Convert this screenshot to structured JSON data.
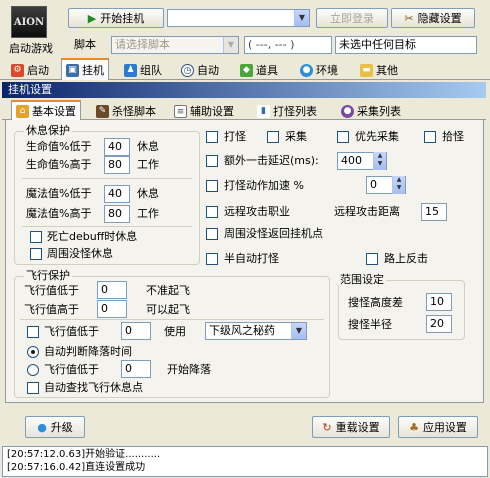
{
  "app": {
    "logo": "AION",
    "start_game": "启动游戏"
  },
  "toolbar": {
    "start_hook": "开始挂机",
    "role_select": "",
    "login": "立即登录",
    "hide_settings": "隐藏设置"
  },
  "script_row": {
    "label": "脚本",
    "script_placeholder": "请选择脚本",
    "coords": "( ---, --- )",
    "target": "未选中任何目标"
  },
  "main_tabs": [
    {
      "label": "启动",
      "icon": "gear-icon"
    },
    {
      "label": "挂机",
      "icon": "monitor-icon"
    },
    {
      "label": "组队",
      "icon": "team-icon"
    },
    {
      "label": "自动",
      "icon": "clock-icon"
    },
    {
      "label": "道具",
      "icon": "bag-icon"
    },
    {
      "label": "环境",
      "icon": "globe-icon"
    },
    {
      "label": "其他",
      "icon": "folder-icon"
    }
  ],
  "section_title": "挂机设置",
  "sub_tabs": [
    {
      "label": "基本设置",
      "icon": "home-icon"
    },
    {
      "label": "杀怪脚本",
      "icon": "pen-icon"
    },
    {
      "label": "辅助设置",
      "icon": "doc-icon"
    },
    {
      "label": "打怪列表",
      "icon": "bar-chart-icon"
    },
    {
      "label": "采集列表",
      "icon": "globe-icon"
    }
  ],
  "rest": {
    "title": "休息保护",
    "hp_low_label": "生命值%低于",
    "hp_low": "40",
    "rest_word": "休息",
    "hp_high_label": "生命值%高于",
    "hp_high": "80",
    "work_word": "工作",
    "mp_low_label": "魔法值%低于",
    "mp_low": "40",
    "mp_high_label": "魔法值%高于",
    "mp_high": "80",
    "debuff_rest": "死亡debuff时休息",
    "around_rest": "周围没怪休息"
  },
  "options": {
    "attack": "打怪",
    "gather": "采集",
    "gather_first": "优先采集",
    "pickup": "拾怪",
    "extra_delay": "额外一击延迟(ms):",
    "extra_delay_val": "400",
    "speed_up": "打怪动作加速 %",
    "speed_up_val": "0",
    "ranged_job": "远程攻击职业",
    "ranged_dist_label": "远程攻击距离",
    "ranged_dist": "15",
    "no_mob_return": "周围没怪返回挂机点",
    "semi_auto": "半自动打怪",
    "road_counter": "路上反击"
  },
  "fly": {
    "title": "飞行保护",
    "low_label": "飞行值低于",
    "low_val": "0",
    "low_note": "不准起飞",
    "high_label": "飞行值高于",
    "high_val": "0",
    "high_note": "可以起飞",
    "use_low_label": "飞行值低于",
    "use_low_val": "0",
    "use_word": "使用",
    "potion": "下级风之秘药",
    "auto_land": "自动判断降落时间",
    "land_low_label": "飞行值低于",
    "land_low_val": "0",
    "land_note": "开始降落",
    "find_rest": "自动查找飞行休息点"
  },
  "range": {
    "title": "范围设定",
    "height_label": "搜怪高度差",
    "height_val": "10",
    "radius_label": "搜怪半径",
    "radius_val": "20"
  },
  "bottom": {
    "upgrade": "升级",
    "reload": "重载设置",
    "apply": "应用设置"
  },
  "log": [
    "[20:57:12.0.63]开始验证...........",
    "[20:57:16.0.42]直连设置成功"
  ]
}
